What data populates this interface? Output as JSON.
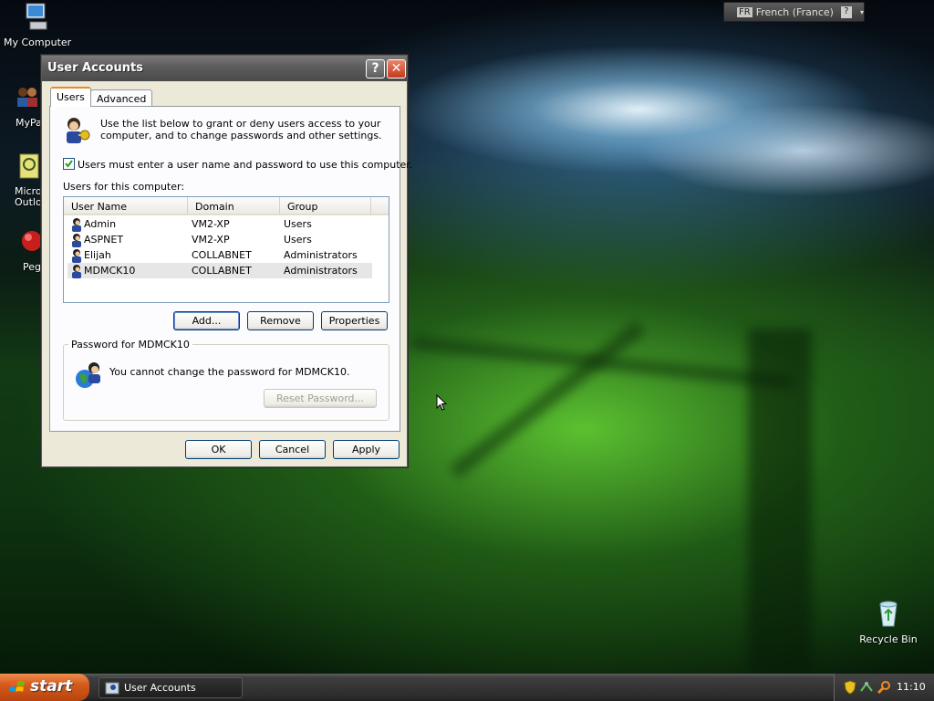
{
  "desktop": {
    "icons": [
      {
        "label": "My Computer"
      },
      {
        "label": "MyPa"
      },
      {
        "label": "Micros\nOutlo"
      },
      {
        "label": "Peg"
      },
      {
        "label": "Recycle Bin"
      }
    ]
  },
  "langbar": {
    "code": "FR",
    "language": "French (France)",
    "help": "?"
  },
  "dialog": {
    "title": "User Accounts",
    "help_glyph": "?",
    "close_glyph": "✕",
    "tabs": [
      {
        "label": "Users",
        "active": true
      },
      {
        "label": "Advanced",
        "active": false
      }
    ],
    "intro_text": "Use the list below to grant or deny users access to your computer, and to change passwords and other settings.",
    "must_login_label": "Users must enter a user name and password to use this computer.",
    "must_login_checked": true,
    "users_label": "Users for this computer:",
    "columns": [
      "User Name",
      "Domain",
      "Group"
    ],
    "users": [
      {
        "name": "Admin",
        "domain": "VM2-XP",
        "group": "Users"
      },
      {
        "name": "ASPNET",
        "domain": "VM2-XP",
        "group": "Users"
      },
      {
        "name": "Elijah",
        "domain": "COLLABNET",
        "group": "Administrators"
      },
      {
        "name": "MDMCK10",
        "domain": "COLLABNET",
        "group": "Administrators"
      }
    ],
    "selected_user": "MDMCK10",
    "add_label": "Add...",
    "remove_label": "Remove",
    "properties_label": "Properties",
    "password_group_label": "Password for MDMCK10",
    "password_message": "You cannot change the password for MDMCK10.",
    "reset_password_label": "Reset Password...",
    "ok_label": "OK",
    "cancel_label": "Cancel",
    "apply_label": "Apply"
  },
  "taskbar": {
    "start_label": "start",
    "task_label": "User Accounts",
    "clock": "11:10"
  },
  "colors": {
    "accent_tab": "#e68b2c",
    "start_orange": "#d45a1c",
    "list_border": "#7f9db9"
  }
}
